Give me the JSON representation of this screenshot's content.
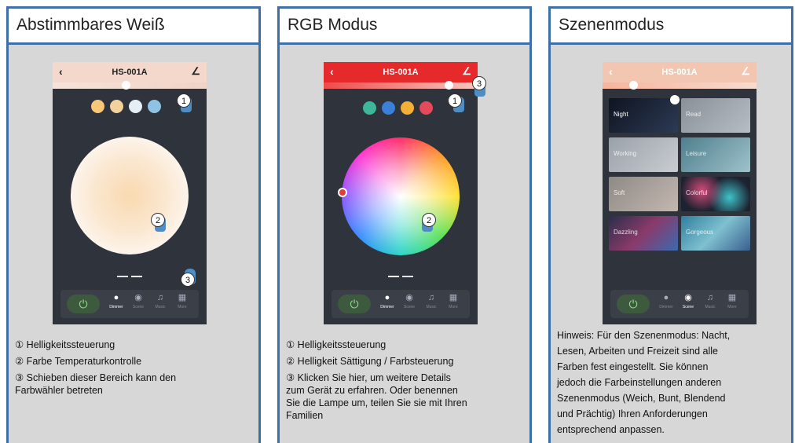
{
  "panels": {
    "white": {
      "title": "Abstimmbares Weiß",
      "app_title": "HS-001A",
      "back_icon": "‹",
      "edit_icon": "∠",
      "nav": [
        "Dimmer",
        "Scene",
        "Music",
        "More"
      ],
      "markers": [
        "1",
        "2",
        "3"
      ],
      "captions": [
        "① Helligkeitssteuerung",
        "② Farbe Temperaturkontrolle",
        "③ Schieben dieser Bereich kann den\nFarbwähler betreten"
      ]
    },
    "rgb": {
      "title": "RGB Modus",
      "app_title": "HS-001A",
      "back_icon": "‹",
      "nav": [
        "Dimmer",
        "Scene",
        "Music",
        "More"
      ],
      "markers": [
        "1",
        "2",
        "3"
      ],
      "captions": [
        "① Helligkeitssteuerung",
        "② Helligkeit Sättigung / Farbsteuerung",
        "③ Klicken Sie hier, um weitere Details\nzum Gerät zu erfahren. Oder benennen\nSie die Lampe um, teilen Sie sie mit Ihren\nFamilien"
      ]
    },
    "scene": {
      "title": "Szenenmodus",
      "app_title": "HS-001A",
      "back_icon": "‹",
      "edit_icon": "∠",
      "scenes": [
        "Night",
        "Read",
        "Working",
        "Leisure",
        "Soft",
        "Colorful",
        "Dazzling",
        "Gorgeous"
      ],
      "nav": [
        "Dimmer",
        "Scene",
        "Music",
        "More"
      ],
      "note": "Hinweis: Für den Szenenmodus: Nacht,\nLesen, Arbeiten und Freizeit sind alle\nFarben fest eingestellt. Sie können\n jedoch die Farbeinstellungen anderen\nSzenenmodus (Weich, Bunt, Blendend\nund Prächtig) Ihren Anforderungen\nentsprechend anpassen."
    }
  },
  "colors": {
    "frame": "#3f6fa9",
    "red_header": "#e6292b",
    "peach_header": "#f3c6b2"
  }
}
